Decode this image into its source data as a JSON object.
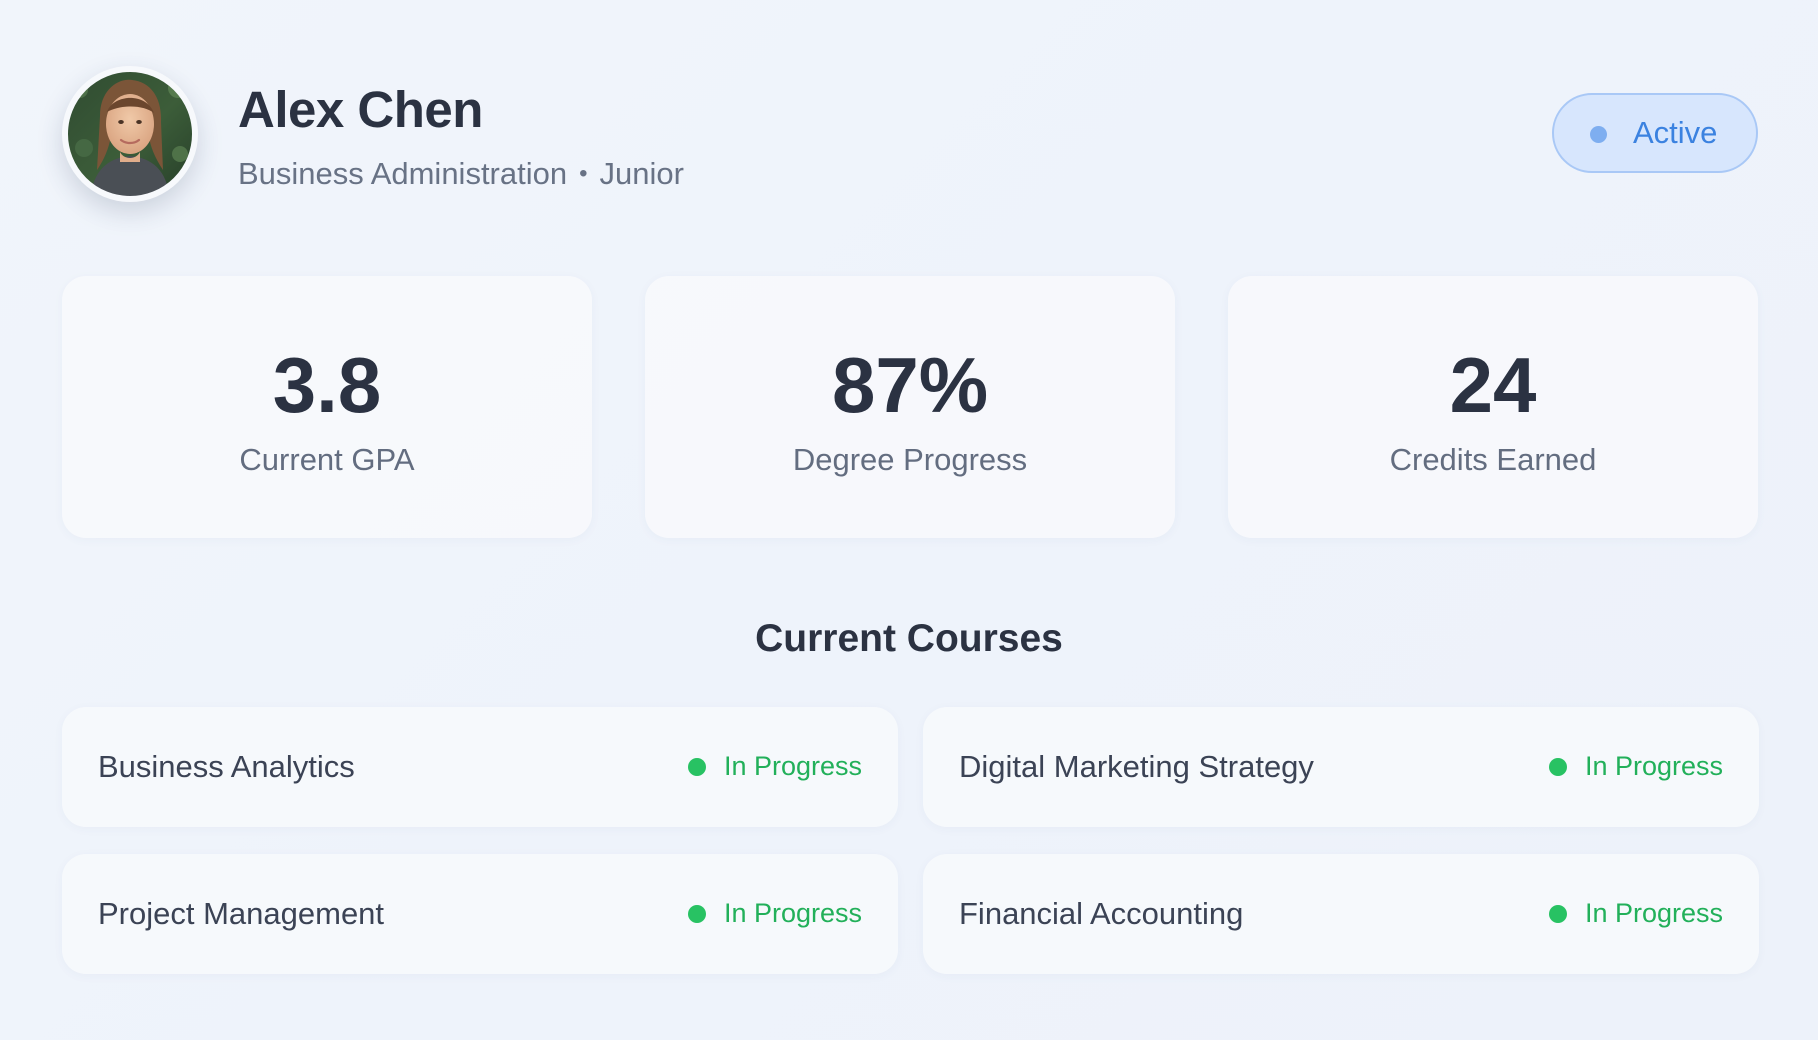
{
  "profile": {
    "name": "Alex Chen",
    "major": "Business Administration",
    "separator": "•",
    "year": "Junior",
    "status": "Active",
    "status_color": "#3b82e0"
  },
  "stats": [
    {
      "value": "3.8",
      "label": "Current GPA"
    },
    {
      "value": "87%",
      "label": "Degree Progress"
    },
    {
      "value": "24",
      "label": "Credits Earned"
    }
  ],
  "courses_section": {
    "title": "Current Courses",
    "items": [
      {
        "name": "Business Analytics",
        "status": "In Progress"
      },
      {
        "name": "Digital Marketing Strategy",
        "status": "In Progress"
      },
      {
        "name": "Project Management",
        "status": "In Progress"
      },
      {
        "name": "Financial Accounting",
        "status": "In Progress"
      }
    ],
    "status_color": "#22b05a"
  },
  "icons": {
    "avatar": "profile-photo",
    "status_dot": "status-dot-icon",
    "course_status_dot": "course-status-dot-icon"
  }
}
